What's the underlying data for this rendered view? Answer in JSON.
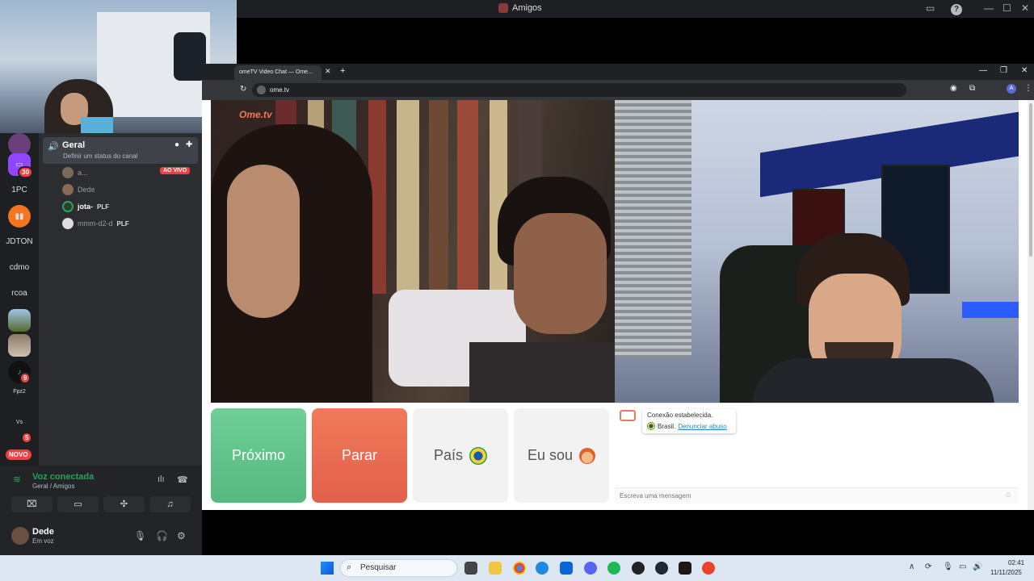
{
  "window": {
    "title": "Amigos"
  },
  "rail": {
    "servers": [
      {
        "label": "1PC"
      },
      {
        "label": "JDTON"
      },
      {
        "label": "cdmo"
      },
      {
        "label": "rcoa"
      },
      {
        "label": "Fpz2"
      },
      {
        "label": "Vs"
      }
    ],
    "badges": {
      "twitch": "30",
      "music": "9",
      "vs": "5"
    },
    "new_label": "NOVO"
  },
  "channel": {
    "name": "Geral",
    "status": "Definir um status do canal",
    "live_badge": "AO VIVO",
    "members": [
      {
        "name": "a...",
        "tag": ""
      },
      {
        "name": "Dede",
        "tag": ""
      },
      {
        "name": "jota-",
        "tag": "PLF"
      },
      {
        "name": "mmm-d2-d",
        "tag": "PLF"
      }
    ]
  },
  "voice": {
    "title": "Voz conectada",
    "subtitle": "Geral / Amigos",
    "user_name": "Dede",
    "user_status": "Em voz"
  },
  "browser": {
    "tab_title": "omeTV Video Chat — Ome...",
    "url": "ome.tv"
  },
  "app": {
    "logo": "Ome.tv",
    "next_label": "Próximo",
    "stop_label": "Parar",
    "country_label": "País",
    "gender_label": "Eu sou",
    "chat": {
      "connected": "Conexão estabelecida.",
      "country": "Brasil.",
      "report_link": "Denunciar abuso",
      "input_placeholder": "Escreva uma mensagem"
    }
  },
  "taskbar": {
    "search_label": "Pesquisar",
    "time": "02:41",
    "date": "11/11/2025"
  },
  "colors": {
    "discord_bg": "#2b2d31",
    "voice_green": "#23a55a",
    "next_green": "#6fcf97",
    "stop_orange": "#f07a5a",
    "live_red": "#f23f43"
  }
}
